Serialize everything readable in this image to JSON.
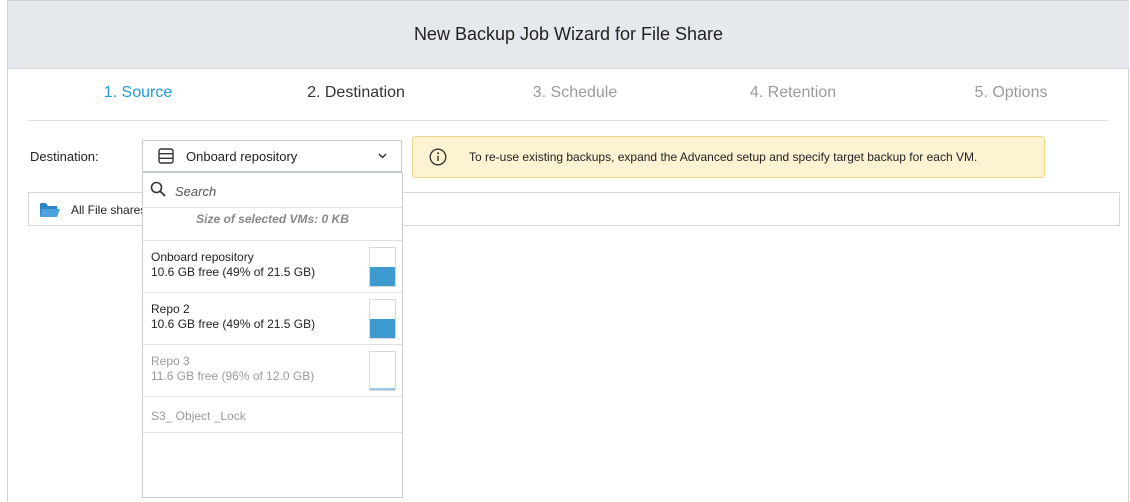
{
  "wizard": {
    "title": "New Backup Job Wizard for File Share"
  },
  "steps": [
    {
      "label": "1. Source",
      "state": "done"
    },
    {
      "label": "2. Destination",
      "state": "current"
    },
    {
      "label": "3. Schedule",
      "state": "upcoming"
    },
    {
      "label": "4. Retention",
      "state": "upcoming"
    },
    {
      "label": "5. Options",
      "state": "upcoming"
    }
  ],
  "destination": {
    "label": "Destination:",
    "selected": "Onboard repository",
    "search_placeholder": "Search",
    "size_text": "Size of selected VMs: 0 KB",
    "repositories": [
      {
        "name": "Onboard repository",
        "free": "10.6 GB free (49% of 21.5 GB)",
        "used_fraction": 0.51,
        "enabled": true
      },
      {
        "name": "Repo 2",
        "free": "10.6 GB free (49% of 21.5 GB)",
        "used_fraction": 0.51,
        "enabled": true
      },
      {
        "name": "Repo 3",
        "free": "11.6 GB free (96% of 12.0 GB)",
        "used_fraction": 0.04,
        "enabled": false
      },
      {
        "name": "S3_ Object _Lock",
        "enabled": false
      }
    ]
  },
  "info": {
    "text": "To re-use existing backups, expand the Advanced setup and specify target backup for each VM."
  },
  "tree": {
    "label": "All File shares"
  },
  "colors": {
    "accent": "#1f9bd6",
    "header_bg": "#e5e8ec",
    "info_bg": "#fdf3d3",
    "bar_fill": "#3d9bd0"
  }
}
